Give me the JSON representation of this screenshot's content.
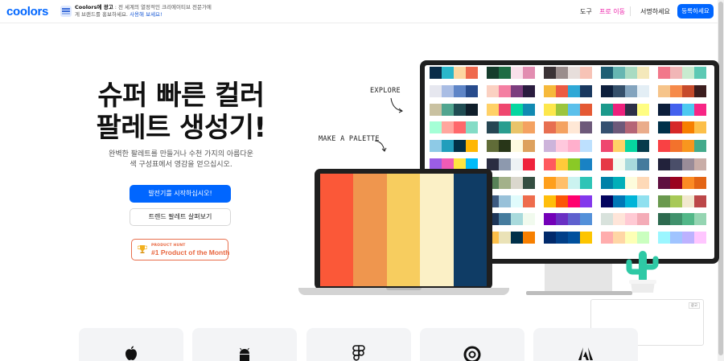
{
  "header": {
    "logo": "coolors",
    "ad": {
      "brand": "Coolors에 광고",
      "text": " : 전 세계의 열정적인 크리에이티브 전문가에게 브랜드를 홍보하세요.",
      "link": "사용해 보세요!"
    },
    "nav": {
      "tools": "도구",
      "pro": "프로 이동",
      "login": "서명하세요",
      "signup": "등록하세요"
    }
  },
  "hero": {
    "title_line1": "슈퍼 빠른 컬러",
    "title_line2": "팔레트 생성기!",
    "subtitle_line1": "완벽한 팔레트를 만들거나 수천 가지의 아름다운",
    "subtitle_line2": "색 구성표에서 영감을 얻으십시오.",
    "start_button": "발전기를 시작하십시오!",
    "trend_button": "트렌드 팔레트 살펴보기",
    "badge_small": "PRODUCT HUNT",
    "badge_big": "#1 Product of the Month"
  },
  "illustration": {
    "explore": "EXPLORE",
    "make_palette": "MAKE A PALETTE",
    "laptop_palette": [
      "#fb5838",
      "#ef964e",
      "#f7cd5f",
      "#fbf0c6",
      "#0f3c65"
    ],
    "monitor_palettes": [
      [
        "#0a2d49",
        "#2ab7ca",
        "#fdd7a1",
        "#ef6a4e"
      ],
      [
        "#153d2c",
        "#1e6c43",
        "#f9e0ea",
        "#e28db1"
      ],
      [
        "#3b3336",
        "#9a8d8c",
        "#e7dedb",
        "#f7c3b6"
      ],
      [
        "#1f5f74",
        "#66b6b2",
        "#a9dbc2",
        "#f4e8ba"
      ],
      [
        "#f2778a",
        "#f1b6b6",
        "#c8ebcf",
        "#5cc9b4"
      ],
      [
        "#e6e7ef",
        "#a9bde4",
        "#5e85c7",
        "#274b8c"
      ],
      [
        "#fbd1c2",
        "#f47fa2",
        "#7c3d7e",
        "#2a1c3f"
      ],
      [
        "#f6b93b",
        "#ec5b43",
        "#2ea8d6",
        "#19385f"
      ],
      [
        "#0d1f3c",
        "#35506b",
        "#83a4be",
        "#e3eef5"
      ],
      [
        "#f6c48a",
        "#f68a4a",
        "#c64a2b",
        "#3c1d1e"
      ],
      [
        "#c9c1a1",
        "#51a58f",
        "#204d53",
        "#0f1e2a"
      ],
      [
        "#ffd167",
        "#ef476f",
        "#06d6a0",
        "#118ab2"
      ],
      [
        "#fde74c",
        "#9bc53d",
        "#5bc0eb",
        "#e55934"
      ],
      [
        "#1b998b",
        "#ed217c",
        "#2d3047",
        "#fffd82"
      ],
      [
        "#0b1d3a",
        "#4361ee",
        "#4cc9f0",
        "#f72585"
      ],
      [
        "#a5ffd6",
        "#ffa69e",
        "#ff686b",
        "#84dcc6"
      ],
      [
        "#264653",
        "#2a9d8f",
        "#e9c46a",
        "#f4a261"
      ],
      [
        "#e76f51",
        "#f4a261",
        "#ffe8d6",
        "#6d597a"
      ],
      [
        "#355070",
        "#6d597a",
        "#b56576",
        "#eaac8b"
      ],
      [
        "#003049",
        "#d62828",
        "#f77f00",
        "#fcbf49"
      ],
      [
        "#8ecae6",
        "#219ebc",
        "#023047",
        "#ffb703"
      ],
      [
        "#606c38",
        "#283618",
        "#fefae0",
        "#dda15e"
      ],
      [
        "#cdb4db",
        "#ffc8dd",
        "#ffafcc",
        "#bde0fe"
      ],
      [
        "#ef476f",
        "#ffd166",
        "#06d6a0",
        "#073b4c"
      ],
      [
        "#f94144",
        "#f3722c",
        "#f8961e",
        "#43aa8b"
      ],
      [
        "#9b5de5",
        "#f15bb5",
        "#fee440",
        "#00bbf9"
      ],
      [
        "#2b2d42",
        "#8d99ae",
        "#edf2f4",
        "#ef233c"
      ],
      [
        "#ff595e",
        "#ffca3a",
        "#8ac926",
        "#1982c4"
      ],
      [
        "#e63946",
        "#f1faee",
        "#a8dadc",
        "#457b9d"
      ],
      [
        "#22223b",
        "#4a4e69",
        "#9a8c98",
        "#c9ada7"
      ],
      [
        "#14213d",
        "#fca311",
        "#e5e5e5",
        "#000000"
      ],
      [
        "#588157",
        "#a3b18a",
        "#dad7cd",
        "#344e41"
      ],
      [
        "#ff9f1c",
        "#ffbf69",
        "#cbf3f0",
        "#2ec4b6"
      ],
      [
        "#0081a7",
        "#00afb9",
        "#fdfcdc",
        "#fed9b7"
      ],
      [
        "#5f0f40",
        "#9a031e",
        "#fb8b24",
        "#e36414"
      ],
      [
        "#f72585",
        "#7209b7",
        "#3a0ca3",
        "#4cc9f0"
      ],
      [
        "#3d5a80",
        "#98c1d9",
        "#e0fbfc",
        "#ee6c4d"
      ],
      [
        "#ffbe0b",
        "#fb5607",
        "#ff006e",
        "#8338ec"
      ],
      [
        "#03045e",
        "#0077b6",
        "#00b4d8",
        "#90e0ef"
      ],
      [
        "#6a994e",
        "#a7c957",
        "#f2e8cf",
        "#bc4749"
      ],
      [
        "#ffcdb2",
        "#ffb4a2",
        "#e5989b",
        "#b5838d"
      ],
      [
        "#1d3557",
        "#457b9d",
        "#a8dadc",
        "#f1faee"
      ],
      [
        "#7400b8",
        "#6930c3",
        "#5e60ce",
        "#5390d9"
      ],
      [
        "#d8e2dc",
        "#ffe5d9",
        "#ffcad4",
        "#f4acb7"
      ],
      [
        "#2d6a4f",
        "#40916c",
        "#52b788",
        "#95d5b2"
      ],
      [
        "#ff0054",
        "#9e0059",
        "#390099",
        "#ffbd00"
      ],
      [
        "#fcbf49",
        "#eae2b7",
        "#003049",
        "#f77f00"
      ],
      [
        "#00296b",
        "#003f88",
        "#00509d",
        "#fdc500"
      ],
      [
        "#ffadad",
        "#ffd6a5",
        "#fdffb6",
        "#caffbf"
      ],
      [
        "#9bf6ff",
        "#a0c4ff",
        "#bdb2ff",
        "#ffc6ff"
      ],
      [
        "#f08080",
        "#f4978e",
        "#f8ad9d",
        "#fbc4ab"
      ],
      [
        "#3c096c",
        "#5a189a",
        "#7b2cbf",
        "#9d4edd"
      ],
      [
        "#e07a5f",
        "#3d405b",
        "#81b29a",
        "#f2cc8f"
      ],
      [
        "#f5ebe0",
        "#e3d5ca",
        "#d5bdaf",
        "#d6ccc2"
      ],
      [
        "#0b132b",
        "#1c2541",
        "#3a506b",
        "#5bc0be"
      ],
      [
        "#ee9b00",
        "#ca6702",
        "#bb3e03",
        "#ae2012"
      ],
      [
        "#e9d8a6",
        "#94d2bd",
        "#0a9396",
        "#005f73"
      ],
      [
        "#ff7b00",
        "#ff8800",
        "#ff9500",
        "#ffa200"
      ],
      [
        "#f8f9fa",
        "#dee2e6",
        "#adb5bd",
        "#495057"
      ],
      [
        "#80ffdb",
        "#72efdd",
        "#64dfdf",
        "#56cfe1"
      ],
      [
        "#ffcbf2",
        "#f3c4fb",
        "#ecbcfd",
        "#e5b3fe"
      ],
      [
        "#390099",
        "#9e0059",
        "#ff0054",
        "#ff5400"
      ],
      [
        "#cad2c5",
        "#84a98c",
        "#52796f",
        "#354f52"
      ],
      [
        "#10002b",
        "#240046",
        "#3c096c",
        "#5a189a"
      ],
      [
        "#ffe169",
        "#fad643",
        "#edc531",
        "#dbb42c"
      ],
      [
        "#ff8fa3",
        "#ff758f",
        "#ff4d6d",
        "#c9184a"
      ],
      [
        "#006466",
        "#065a60",
        "#0b525b",
        "#144552"
      ],
      [
        "#fec5bb",
        "#fcd5ce",
        "#fae1dd",
        "#f8edeb"
      ],
      [
        "#ffb5a7",
        "#fcd5ce",
        "#f8edeb",
        "#f9dcc4"
      ],
      [
        "#2b9348",
        "#55a630",
        "#80b918",
        "#aacc00"
      ]
    ]
  },
  "ad_box": {
    "label": "광고"
  },
  "platforms": [
    {
      "icon": "apple-icon"
    },
    {
      "icon": "android-icon"
    },
    {
      "icon": "figma-icon"
    },
    {
      "icon": "chrome-icon"
    },
    {
      "icon": "adobe-icon"
    }
  ]
}
